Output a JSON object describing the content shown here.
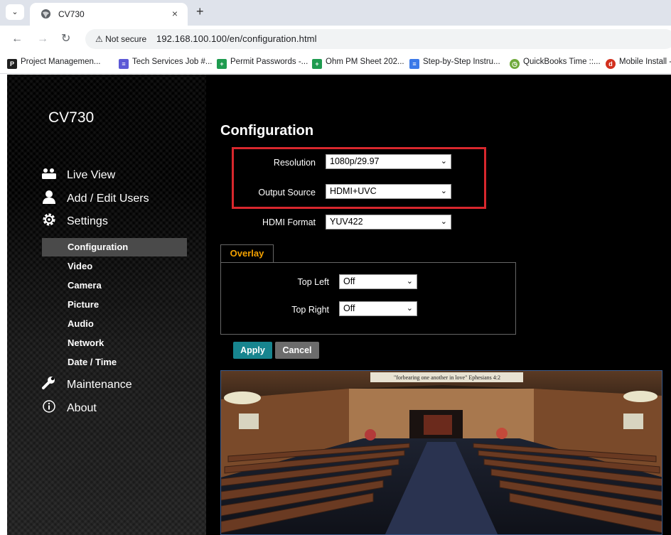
{
  "browser": {
    "tab_title": "CV730",
    "new_tab_label": "+",
    "close_label": "×",
    "security_label": "Not secure",
    "url": "192.168.100.100/en/configuration.html",
    "bookmarks": [
      {
        "label": "Project Managemen...",
        "icon_color": "#1f1f1f",
        "icon_text": "P"
      },
      {
        "label": "Tech Services Job #...",
        "icon_color": "#5c59d6",
        "icon_text": "≡"
      },
      {
        "label": "Permit Passwords -...",
        "icon_color": "#1e9b4f",
        "icon_text": "+"
      },
      {
        "label": "Ohm PM Sheet 202...",
        "icon_color": "#1e9b4f",
        "icon_text": "+"
      },
      {
        "label": "Step-by-Step Instru...",
        "icon_color": "#3b79e8",
        "icon_text": "≡"
      },
      {
        "label": "QuickBooks Time ::...",
        "icon_color": "#6fa93b",
        "icon_text": "◷"
      },
      {
        "label": "Mobile Install -",
        "icon_color": "#d2301e",
        "icon_text": "d"
      }
    ]
  },
  "sidebar": {
    "brand": "CV730",
    "nav": [
      {
        "label": "Live View",
        "icon": "camera-people-icon"
      },
      {
        "label": "Add / Edit Users",
        "icon": "user-icon"
      },
      {
        "label": "Settings",
        "icon": "gear-icon"
      }
    ],
    "settings_items": [
      "Configuration",
      "Video",
      "Camera",
      "Picture",
      "Audio",
      "Network",
      "Date / Time"
    ],
    "active_item": "Configuration",
    "nav_bottom": [
      {
        "label": "Maintenance",
        "icon": "wrench-icon"
      },
      {
        "label": "About",
        "icon": "info-icon"
      }
    ]
  },
  "main": {
    "title": "Configuration",
    "fields": [
      {
        "label": "Resolution",
        "value": "1080p/29.97"
      },
      {
        "label": "Output Source",
        "value": "HDMI+UVC"
      },
      {
        "label": "HDMI Format",
        "value": "YUV422"
      }
    ],
    "overlay": {
      "tab_label": "Overlay",
      "fields": [
        {
          "label": "Top Left",
          "value": "Off"
        },
        {
          "label": "Top Right",
          "value": "Off"
        }
      ]
    },
    "apply_label": "Apply",
    "cancel_label": "Cancel",
    "video_banner": "\"forbearing one another in love\"  Ephesians 4:2"
  },
  "colors": {
    "accent_orange": "#f3a100",
    "apply_teal": "#17858f",
    "highlight_red": "#d8272d"
  }
}
